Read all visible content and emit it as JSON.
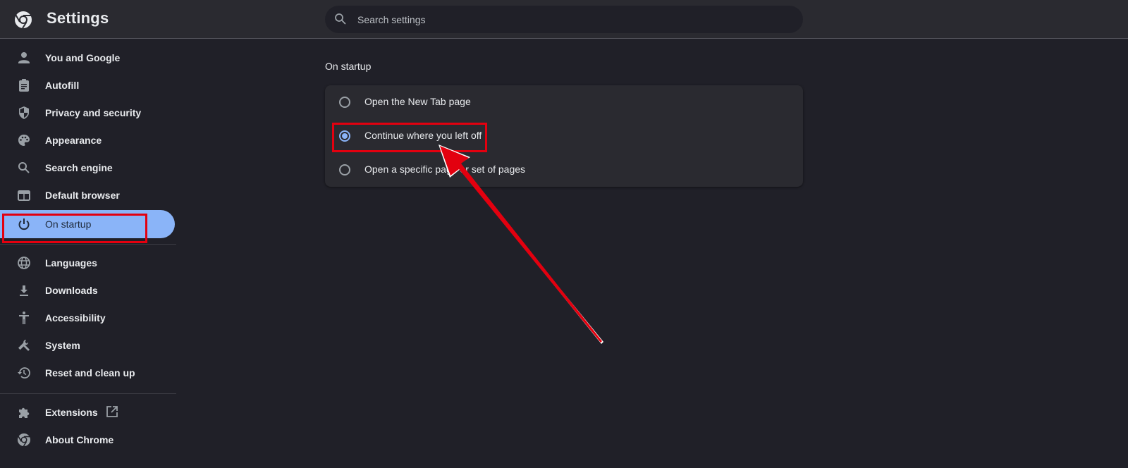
{
  "header": {
    "app_title": "Settings",
    "logo_icon": "chrome-logo-icon",
    "search": {
      "placeholder": "Search settings",
      "value": "",
      "icon": "search-icon"
    }
  },
  "sidebar": {
    "items": [
      {
        "label": "You and Google",
        "icon": "person-icon"
      },
      {
        "label": "Autofill",
        "icon": "clipboard-icon"
      },
      {
        "label": "Privacy and security",
        "icon": "shield-icon"
      },
      {
        "label": "Appearance",
        "icon": "palette-icon"
      },
      {
        "label": "Search engine",
        "icon": "search-icon"
      },
      {
        "label": "Default browser",
        "icon": "browser-window-icon"
      },
      {
        "label": "On startup",
        "icon": "power-icon",
        "active": true
      },
      {
        "label": "Languages",
        "icon": "globe-icon"
      },
      {
        "label": "Downloads",
        "icon": "download-icon"
      },
      {
        "label": "Accessibility",
        "icon": "accessibility-icon"
      },
      {
        "label": "System",
        "icon": "wrench-icon"
      },
      {
        "label": "Reset and clean up",
        "icon": "history-icon"
      },
      {
        "label": "Extensions",
        "icon": "puzzle-icon",
        "external": true
      },
      {
        "label": "About Chrome",
        "icon": "chrome-logo-icon"
      }
    ]
  },
  "main": {
    "section_title": "On startup",
    "options": [
      {
        "label": "Open the New Tab page",
        "checked": false
      },
      {
        "label": "Continue where you left off",
        "checked": true
      },
      {
        "label": "Open a specific page or set of pages",
        "checked": false
      }
    ]
  },
  "colors": {
    "accent": "#8ab4f8",
    "annotation": "#e3000f",
    "background": "#202028",
    "header": "#2a2a30"
  }
}
